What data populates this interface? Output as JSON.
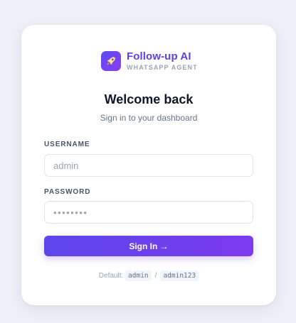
{
  "brand": {
    "name": "Follow-up AI",
    "subtitle": "WHATSAPP AGENT",
    "logo_icon": "rocket-icon",
    "accent": "#5b3fe6"
  },
  "heading": {
    "title": "Welcome back",
    "subtitle": "Sign in to your dashboard"
  },
  "form": {
    "username": {
      "label": "USERNAME",
      "value": "",
      "placeholder": "admin"
    },
    "password": {
      "label": "PASSWORD",
      "value": "",
      "placeholder": "••••••••"
    },
    "submit_label": "Sign In →"
  },
  "defaults": {
    "prefix": "Default:",
    "username": "admin",
    "separator": "/",
    "password": "admin123"
  }
}
